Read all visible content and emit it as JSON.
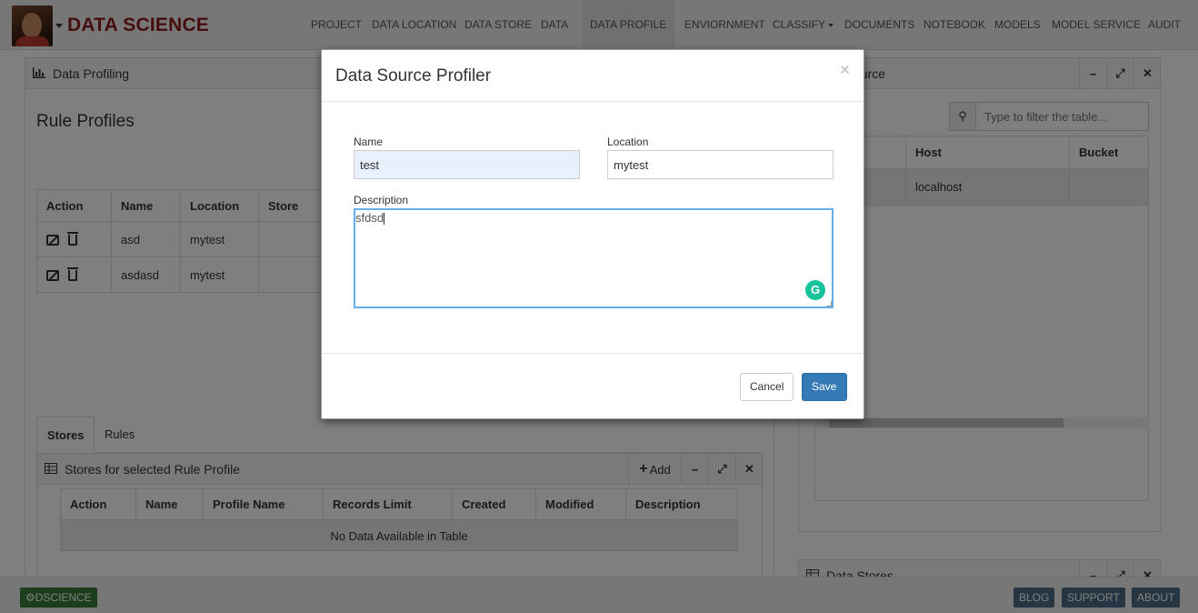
{
  "navbar": {
    "brand": "DATA SCIENCE",
    "items": [
      {
        "label": "PROJECT"
      },
      {
        "label": "DATA LOCATION"
      },
      {
        "label": "DATA STORE"
      },
      {
        "label": "DATA"
      },
      {
        "label": "DATA PROFILE",
        "active": true
      },
      {
        "label": "ENVIORNMENT"
      },
      {
        "label": "CLASSIFY"
      },
      {
        "label": "DOCUMENTS"
      },
      {
        "label": "NOTEBOOK"
      },
      {
        "label": "MODELS"
      },
      {
        "label": "MODEL SERVICE"
      },
      {
        "label": "AUDIT"
      }
    ]
  },
  "left_panel": {
    "title": "Data Profiling",
    "section_title": "Rule Profiles",
    "table": {
      "headers": [
        "Action",
        "Name",
        "Location",
        "Store"
      ],
      "rows": [
        {
          "name": "asd",
          "location": "mytest",
          "store": ""
        },
        {
          "name": "asdasd",
          "location": "mytest",
          "store": ""
        }
      ]
    },
    "tabs": [
      "Stores",
      "Rules"
    ],
    "stores_panel": {
      "title": "Stores for selected Rule Profile",
      "add_label": "Add",
      "headers": [
        "Action",
        "Name",
        "Profile Name",
        "Records Limit",
        "Created",
        "Modified",
        "Description"
      ],
      "empty_text": "No Data Available in Table"
    }
  },
  "right_panel": {
    "title_visible": "ource",
    "search_placeholder": "Type to filter the table...",
    "headers": [
      "Host",
      "Bucket"
    ],
    "rows": [
      {
        "host": "localhost",
        "bucket": ""
      }
    ]
  },
  "bottom_right_panel": {
    "title": "Data Stores"
  },
  "modal": {
    "title": "Data Source Profiler",
    "close_glyph": "×",
    "name_label": "Name",
    "name_value": "test",
    "location_label": "Location",
    "location_value": "mytest",
    "description_label": "Description",
    "description_value": "sfdsd",
    "grammarly_glyph": "G",
    "cancel_label": "Cancel",
    "save_label": "Save"
  },
  "footer": {
    "brand": "DSCIENCE",
    "links": [
      "BLOG",
      "SUPPORT",
      "ABOUT"
    ]
  }
}
